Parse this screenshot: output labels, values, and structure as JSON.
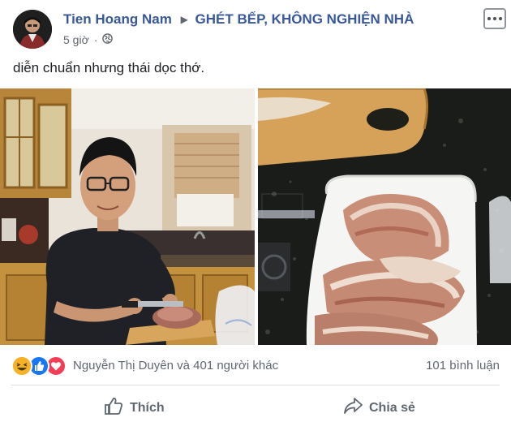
{
  "post": {
    "author": "Tien Hoang Nam",
    "group_arrow": "▶",
    "group": "GHÉT BẾP, KHÔNG NGHIỆN NHÀ",
    "time": "5 giờ",
    "privacy_separator": "·",
    "text": "diễn chuẩn nhưng thái dọc thớ."
  },
  "reactions": {
    "icons": [
      "haha-icon",
      "like-icon",
      "love-icon"
    ],
    "summary": "Nguyễn Thị Duyên và 401 người khác",
    "comments": "101 bình luận"
  },
  "actions": {
    "like_label": "Thích",
    "share_label": "Chia sẻ"
  },
  "colors": {
    "link_blue": "#385898",
    "meta_gray": "#606770",
    "like_blue": "#1877f2",
    "love_red": "#f33e58",
    "haha_yellow": "#f7b125"
  }
}
